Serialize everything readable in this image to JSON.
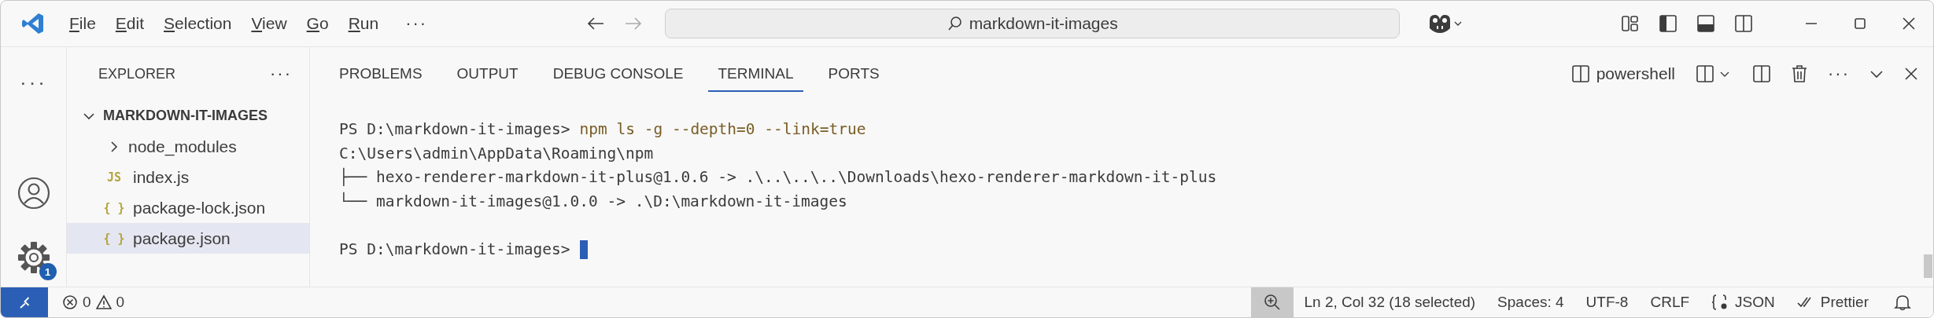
{
  "title_bar": {
    "menu": [
      {
        "label": "File"
      },
      {
        "label": "Edit"
      },
      {
        "label": "Selection"
      },
      {
        "label": "View"
      },
      {
        "label": "Go"
      },
      {
        "label": "Run"
      }
    ],
    "more": "···",
    "search": {
      "value": "markdown-it-images"
    }
  },
  "activity_bar": {
    "more": "···",
    "settings_badge": "1"
  },
  "explorer": {
    "title": "EXPLORER",
    "more": "···",
    "tree": [
      {
        "label": "MARKDOWN-IT-IMAGES",
        "kind": "root",
        "expanded": true,
        "children": [
          {
            "label": "node_modules",
            "kind": "folder",
            "expanded": false,
            "selected": false
          },
          {
            "label": "index.js",
            "kind": "file",
            "icon_text": "JS",
            "selected": false
          },
          {
            "label": "package-lock.json",
            "kind": "file",
            "icon_text": "{ }",
            "selected": false
          },
          {
            "label": "package.json",
            "kind": "file",
            "icon_text": "{ }",
            "selected": true
          }
        ]
      }
    ]
  },
  "panel": {
    "tabs": [
      {
        "label": "PROBLEMS",
        "selected": false
      },
      {
        "label": "OUTPUT",
        "selected": false
      },
      {
        "label": "DEBUG CONSOLE",
        "selected": false
      },
      {
        "label": "TERMINAL",
        "selected": true
      },
      {
        "label": "PORTS",
        "selected": false
      }
    ],
    "shell": "powershell",
    "terminal": [
      {
        "kind": "prompt",
        "prompt": "PS D:\\markdown-it-images>",
        "command": "npm ls -g --depth=0 --link=true",
        "cursor": false
      },
      {
        "kind": "output",
        "text": "C:\\Users\\admin\\AppData\\Roaming\\npm"
      },
      {
        "kind": "output",
        "text": "├── hexo-renderer-markdown-it-plus@1.0.6 -> .\\..\\..\\..\\Downloads\\hexo-renderer-markdown-it-plus"
      },
      {
        "kind": "output",
        "text": "└── markdown-it-images@1.0.0 -> .\\D:\\markdown-it-images"
      },
      {
        "kind": "blank"
      },
      {
        "kind": "prompt",
        "prompt": "PS D:\\markdown-it-images>",
        "cursor": true
      }
    ]
  },
  "status_bar": {
    "errors": "0",
    "warnings": "0",
    "items": [
      {
        "kind": "text",
        "label": "Ln 2, Col 32 (18 selected)"
      },
      {
        "kind": "text",
        "label": "Spaces: 4"
      },
      {
        "kind": "text",
        "label": "UTF-8"
      },
      {
        "kind": "text",
        "label": "CRLF"
      },
      {
        "kind": "language",
        "label": "JSON"
      },
      {
        "kind": "formatter",
        "label": "Prettier"
      }
    ]
  }
}
